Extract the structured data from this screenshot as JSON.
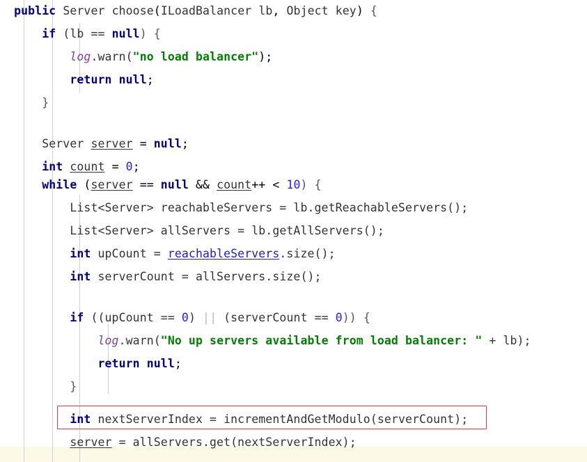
{
  "editor": {
    "language": "java",
    "background_color": "#ffffff",
    "font_size_px": 16.5,
    "line_height_px": 33.3,
    "indent_guide_color": "#cfcfcf",
    "bottom_band_color": "#fdf9e7"
  },
  "annotation": {
    "highlight_box": {
      "color": "#e23b3b",
      "style": "rectangle-outline",
      "target_line_index": 18,
      "target_text": "int nextServerIndex = incrementAndGetModulo(serverCount);"
    }
  },
  "syntax_colors": {
    "keyword": "#000080",
    "string": "#008000",
    "number": "#2020ff",
    "static_field": "#8040a0",
    "plain": "#333333",
    "operator_dim": "#b8b8b8",
    "local_variable_underline": "#333333",
    "link_variable": "#2020c0"
  },
  "code": {
    "lines": [
      {
        "index": 0,
        "indent": 0,
        "text": "public Server choose(ILoadBalancer lb, Object key) {"
      },
      {
        "index": 1,
        "indent": 1,
        "text": "if (lb == null) {"
      },
      {
        "index": 2,
        "indent": 2,
        "text": "log.warn(\"no load balancer\");"
      },
      {
        "index": 3,
        "indent": 2,
        "text": "return null;"
      },
      {
        "index": 4,
        "indent": 1,
        "text": "}"
      },
      {
        "index": 5,
        "indent": 0,
        "text": ""
      },
      {
        "index": 6,
        "indent": 0,
        "text": ""
      },
      {
        "index": 7,
        "indent": 1,
        "text": "Server server = null;"
      },
      {
        "index": 8,
        "indent": 1,
        "text": "int count = 0;"
      },
      {
        "index": 9,
        "indent": 1,
        "text": "while (server == null && count++ < 10) {"
      },
      {
        "index": 10,
        "indent": 2,
        "text": "List<Server> reachableServers = lb.getReachableServers();"
      },
      {
        "index": 11,
        "indent": 2,
        "text": "List<Server> allServers = lb.getAllServers();"
      },
      {
        "index": 12,
        "indent": 2,
        "text": "int upCount = reachableServers.size();"
      },
      {
        "index": 13,
        "indent": 2,
        "text": "int serverCount = allServers.size();"
      },
      {
        "index": 14,
        "indent": 0,
        "text": ""
      },
      {
        "index": 15,
        "indent": 2,
        "text": "if ((upCount == 0) || (serverCount == 0)) {"
      },
      {
        "index": 16,
        "indent": 3,
        "text": "log.warn(\"No up servers available from load balancer: \" + lb);"
      },
      {
        "index": 17,
        "indent": 3,
        "text": "return null;"
      },
      {
        "index": 18,
        "indent": 2,
        "text": "}"
      },
      {
        "index": 19,
        "indent": 0,
        "text": ""
      },
      {
        "index": 20,
        "indent": 2,
        "text": "int nextServerIndex = incrementAndGetModulo(serverCount);"
      },
      {
        "index": 21,
        "indent": 2,
        "text": "server = allServers.get(nextServerIndex);"
      }
    ]
  },
  "tokens": {
    "l0": {
      "kw_public": "public",
      "type_server": " Server",
      "method": " choose",
      "paren_open": "(",
      "param_type1": "ILoadBalancer",
      "param_name1": " lb",
      "comma": ", ",
      "param_type2": "Object",
      "param_name2": " key",
      "paren_close": ")",
      "brace": " {"
    },
    "l1": {
      "kw_if": "if",
      "rest_a": " (lb == ",
      "kw_null": "null",
      "rest_b": ") {"
    },
    "l2": {
      "log": "log",
      "dot_warn": ".warn(",
      "string": "\"no load balancer\"",
      "tail": ");"
    },
    "l3": {
      "kw_return": "return",
      "space": " ",
      "kw_null": "null",
      "semi": ";"
    },
    "l4": {
      "close": "}"
    },
    "l7": {
      "type": "Server ",
      "var": "server",
      "eq": " = ",
      "kw_null": "null",
      "semi": ";"
    },
    "l8": {
      "kw_int": "int",
      "space": " ",
      "var": "count",
      "eq": " = ",
      "num": "0",
      "semi": ";"
    },
    "l9": {
      "kw_while": "while",
      "open": " (",
      "var_server": "server",
      "op_eq": " == ",
      "kw_null": "null",
      "op_and": " && ",
      "var_count": "count",
      "inc": "++ ",
      "lt": "< ",
      "num": "10",
      "close": ") {"
    },
    "l10": {
      "type": "List<Server> reachableServers = lb.getReachableServers();"
    },
    "l11": {
      "type": "List<Server> allServers = lb.getAllServers();"
    },
    "l12": {
      "kw_int": "int",
      "mid": " upCount = ",
      "link": "reachableServers",
      "tail": ".size();"
    },
    "l13": {
      "kw_int": "int",
      "tail": " serverCount = allServers.size();"
    },
    "l15": {
      "kw_if": "if",
      "a": " ((upCount == ",
      "n0": "0",
      "b": ") ",
      "or": "||",
      "c": " (serverCount == ",
      "n1": "0",
      "d": ")) {"
    },
    "l16": {
      "log": "log",
      "dot_warn": ".warn(",
      "string": "\"No up servers available from load balancer: \"",
      "tail": " + lb);"
    },
    "l17": {
      "kw_return": "return",
      "space": " ",
      "kw_null": "null",
      "semi": ";"
    },
    "l18": {
      "close": "}"
    },
    "l20": {
      "kw_int": "int",
      "tail": " nextServerIndex = incrementAndGetModulo(serverCount);"
    },
    "l21": {
      "var": "server",
      "tail": " = allServers.get(nextServerIndex);"
    }
  }
}
